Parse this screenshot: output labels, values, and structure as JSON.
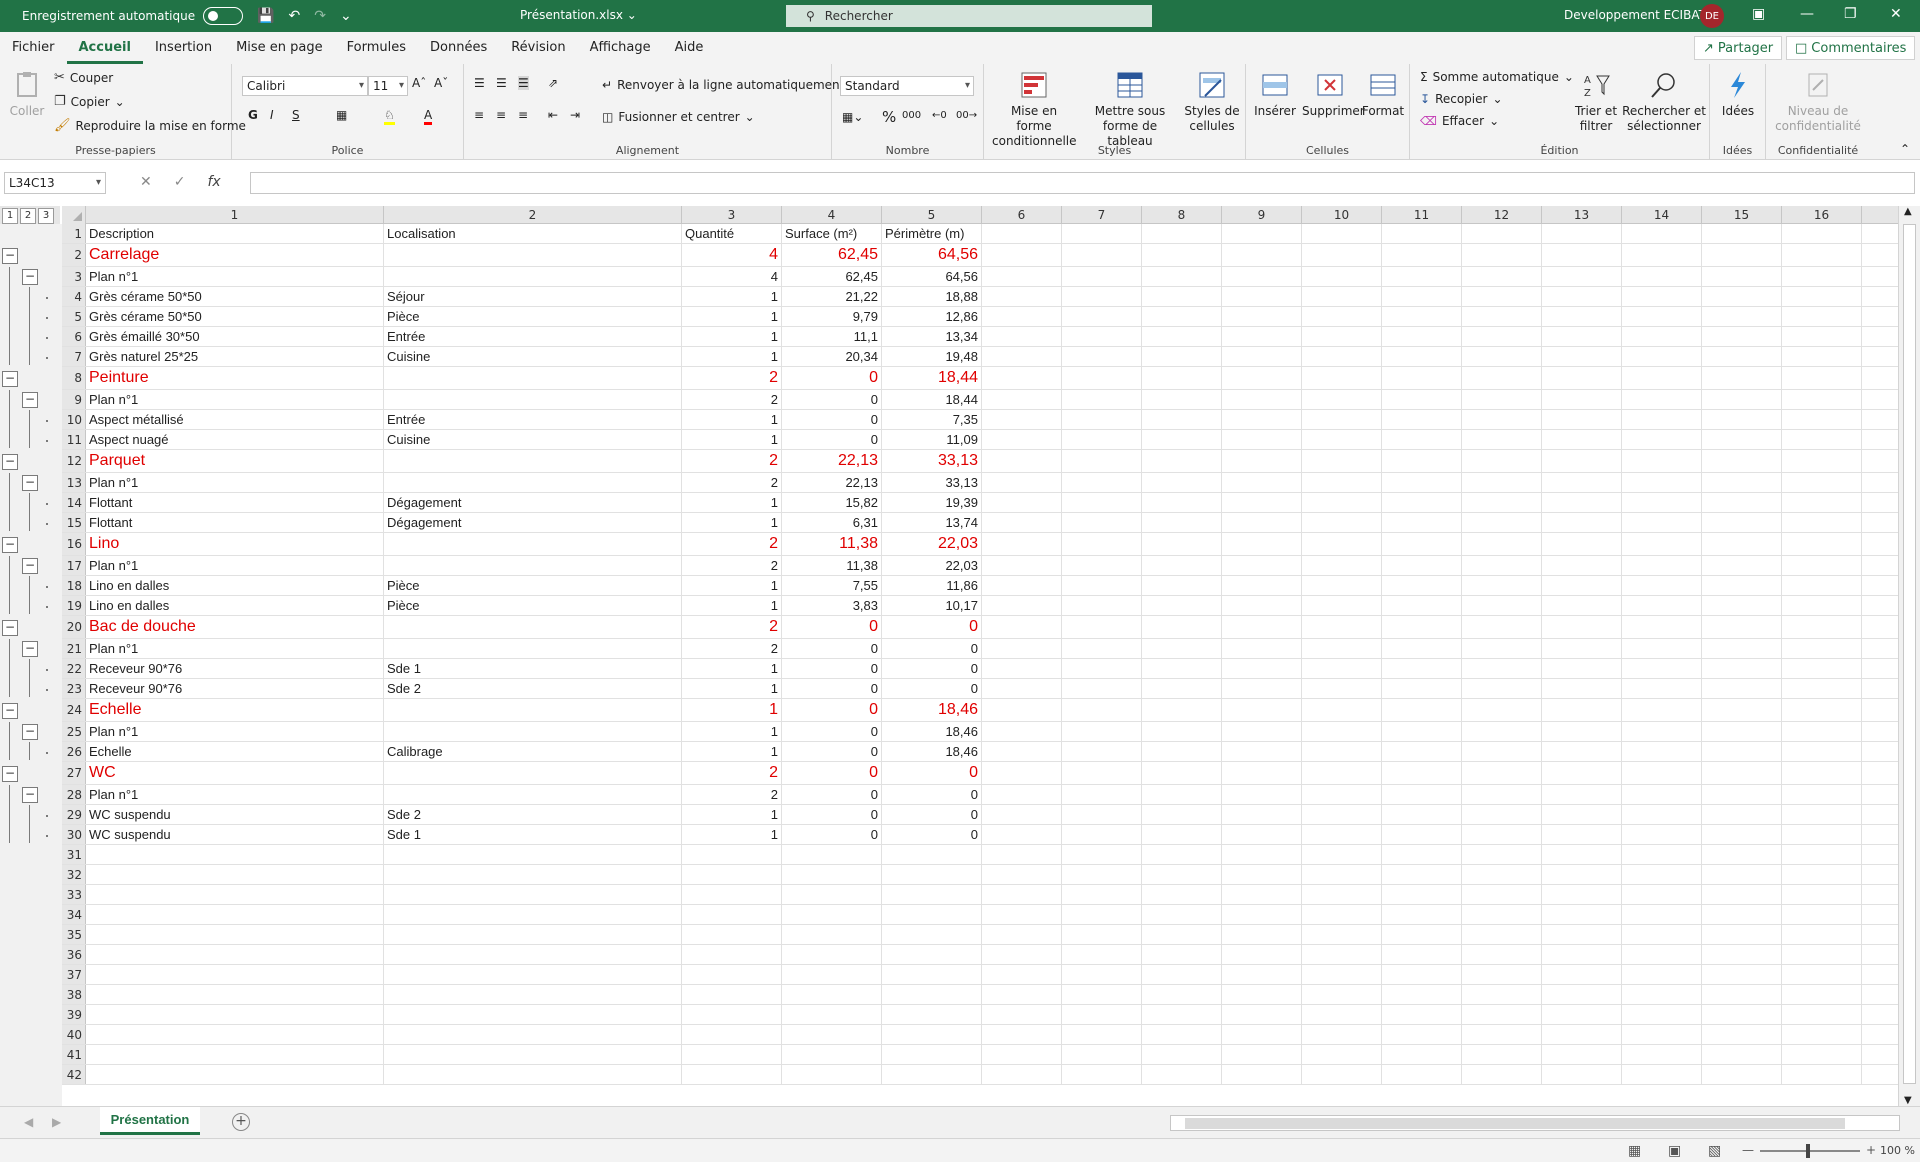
{
  "titlebar": {
    "autosave_label": "Enregistrement automatique",
    "doc_title": "Présentation.xlsx",
    "search_placeholder": "Rechercher",
    "user_name": "Developpement ECIBAT",
    "avatar_initials": "DE"
  },
  "menu": {
    "items": [
      "Fichier",
      "Accueil",
      "Insertion",
      "Mise en page",
      "Formules",
      "Données",
      "Révision",
      "Affichage",
      "Aide"
    ],
    "active": "Accueil",
    "share_label": "Partager",
    "comments_label": "Commentaires"
  },
  "ribbon": {
    "clipboard": {
      "paste_label": "Coller",
      "cut_label": "Couper",
      "copy_label": "Copier",
      "format_painter_label": "Reproduire la mise en forme",
      "group_label": "Presse-papiers"
    },
    "font": {
      "font_name": "Calibri",
      "font_size": "11",
      "group_label": "Police"
    },
    "alignment": {
      "wrap_label": "Renvoyer à la ligne automatiquement",
      "merge_label": "Fusionner et centrer",
      "group_label": "Alignement"
    },
    "number": {
      "format": "Standard",
      "group_label": "Nombre"
    },
    "styles": {
      "conditional_label": "Mise en forme conditionnelle",
      "table_label": "Mettre sous forme de tableau",
      "cell_styles_label": "Styles de cellules",
      "group_label": "Styles"
    },
    "cells": {
      "insert_label": "Insérer",
      "delete_label": "Supprimer",
      "format_label": "Format",
      "group_label": "Cellules"
    },
    "editing": {
      "autosum_label": "Somme automatique",
      "fill_label": "Recopier",
      "clear_label": "Effacer",
      "sort_label": "Trier et filtrer",
      "find_label": "Rechercher et sélectionner",
      "group_label": "Édition"
    },
    "ideas": {
      "ideas_label": "Idées",
      "group_label": "Idées"
    },
    "sensitivity": {
      "label": "Niveau de confidentialité",
      "group_label": "Confidentialité"
    }
  },
  "formula_bar": {
    "name_box": "L34C13",
    "fx_label": "fx",
    "formula": ""
  },
  "grid": {
    "outline_levels": [
      "1",
      "2",
      "3"
    ],
    "columns": [
      "1",
      "2",
      "3",
      "4",
      "5",
      "6",
      "7",
      "8",
      "9",
      "10",
      "11",
      "12",
      "13",
      "14",
      "15",
      "16"
    ],
    "rows": [
      {
        "n": "1",
        "type": "header",
        "c1": "Description",
        "c2": "Localisation",
        "c3": "Quantité",
        "c4": "Surface (m²)",
        "c5": "Périmètre (m)"
      },
      {
        "n": "2",
        "type": "group",
        "c1": "Carrelage",
        "c2": "",
        "c3": "4",
        "c4": "62,45",
        "c5": "64,56"
      },
      {
        "n": "3",
        "type": "plan",
        "c1": "Plan n°1",
        "c2": "",
        "c3": "4",
        "c4": "62,45",
        "c5": "64,56"
      },
      {
        "n": "4",
        "type": "item",
        "c1": "Grès cérame 50*50",
        "c2": "Séjour",
        "c3": "1",
        "c4": "21,22",
        "c5": "18,88"
      },
      {
        "n": "5",
        "type": "item",
        "c1": "Grès cérame 50*50",
        "c2": "Pièce",
        "c3": "1",
        "c4": "9,79",
        "c5": "12,86"
      },
      {
        "n": "6",
        "type": "item",
        "c1": "Grès émaillé 30*50",
        "c2": "Entrée",
        "c3": "1",
        "c4": "11,1",
        "c5": "13,34"
      },
      {
        "n": "7",
        "type": "item",
        "c1": "Grès naturel 25*25",
        "c2": "Cuisine",
        "c3": "1",
        "c4": "20,34",
        "c5": "19,48"
      },
      {
        "n": "8",
        "type": "group",
        "c1": "Peinture",
        "c2": "",
        "c3": "2",
        "c4": "0",
        "c5": "18,44"
      },
      {
        "n": "9",
        "type": "plan",
        "c1": "Plan n°1",
        "c2": "",
        "c3": "2",
        "c4": "0",
        "c5": "18,44"
      },
      {
        "n": "10",
        "type": "item",
        "c1": "Aspect métallisé",
        "c2": "Entrée",
        "c3": "1",
        "c4": "0",
        "c5": "7,35"
      },
      {
        "n": "11",
        "type": "item",
        "c1": "Aspect nuagé",
        "c2": "Cuisine",
        "c3": "1",
        "c4": "0",
        "c5": "11,09"
      },
      {
        "n": "12",
        "type": "group",
        "c1": "Parquet",
        "c2": "",
        "c3": "2",
        "c4": "22,13",
        "c5": "33,13"
      },
      {
        "n": "13",
        "type": "plan",
        "c1": "Plan n°1",
        "c2": "",
        "c3": "2",
        "c4": "22,13",
        "c5": "33,13"
      },
      {
        "n": "14",
        "type": "item",
        "c1": "Flottant",
        "c2": "Dégagement",
        "c3": "1",
        "c4": "15,82",
        "c5": "19,39"
      },
      {
        "n": "15",
        "type": "item",
        "c1": "Flottant",
        "c2": "Dégagement",
        "c3": "1",
        "c4": "6,31",
        "c5": "13,74"
      },
      {
        "n": "16",
        "type": "group",
        "c1": "Lino",
        "c2": "",
        "c3": "2",
        "c4": "11,38",
        "c5": "22,03"
      },
      {
        "n": "17",
        "type": "plan",
        "c1": "Plan n°1",
        "c2": "",
        "c3": "2",
        "c4": "11,38",
        "c5": "22,03"
      },
      {
        "n": "18",
        "type": "item",
        "c1": "Lino en dalles",
        "c2": "Pièce",
        "c3": "1",
        "c4": "7,55",
        "c5": "11,86"
      },
      {
        "n": "19",
        "type": "item",
        "c1": "Lino en dalles",
        "c2": "Pièce",
        "c3": "1",
        "c4": "3,83",
        "c5": "10,17"
      },
      {
        "n": "20",
        "type": "group",
        "c1": "Bac de douche",
        "c2": "",
        "c3": "2",
        "c4": "0",
        "c5": "0"
      },
      {
        "n": "21",
        "type": "plan",
        "c1": "Plan n°1",
        "c2": "",
        "c3": "2",
        "c4": "0",
        "c5": "0"
      },
      {
        "n": "22",
        "type": "item",
        "c1": "Receveur 90*76",
        "c2": "Sde 1",
        "c3": "1",
        "c4": "0",
        "c5": "0"
      },
      {
        "n": "23",
        "type": "item",
        "c1": "Receveur 90*76",
        "c2": "Sde 2",
        "c3": "1",
        "c4": "0",
        "c5": "0"
      },
      {
        "n": "24",
        "type": "group",
        "c1": "Echelle",
        "c2": "",
        "c3": "1",
        "c4": "0",
        "c5": "18,46"
      },
      {
        "n": "25",
        "type": "plan",
        "c1": "Plan n°1",
        "c2": "",
        "c3": "1",
        "c4": "0",
        "c5": "18,46"
      },
      {
        "n": "26",
        "type": "item",
        "c1": "Echelle",
        "c2": "Calibrage",
        "c3": "1",
        "c4": "0",
        "c5": "18,46"
      },
      {
        "n": "27",
        "type": "group",
        "c1": "WC",
        "c2": "",
        "c3": "2",
        "c4": "0",
        "c5": "0"
      },
      {
        "n": "28",
        "type": "plan",
        "c1": "Plan n°1",
        "c2": "",
        "c3": "2",
        "c4": "0",
        "c5": "0"
      },
      {
        "n": "29",
        "type": "item",
        "c1": "WC suspendu",
        "c2": "Sde 2",
        "c3": "1",
        "c4": "0",
        "c5": "0"
      },
      {
        "n": "30",
        "type": "item",
        "c1": "WC suspendu",
        "c2": "Sde 1",
        "c3": "1",
        "c4": "0",
        "c5": "0"
      },
      {
        "n": "31",
        "type": "empty"
      },
      {
        "n": "32",
        "type": "empty"
      },
      {
        "n": "33",
        "type": "empty"
      },
      {
        "n": "34",
        "type": "empty"
      },
      {
        "n": "35",
        "type": "empty"
      },
      {
        "n": "36",
        "type": "empty"
      },
      {
        "n": "37",
        "type": "empty"
      },
      {
        "n": "38",
        "type": "empty"
      },
      {
        "n": "39",
        "type": "empty"
      },
      {
        "n": "40",
        "type": "empty"
      },
      {
        "n": "41",
        "type": "empty"
      },
      {
        "n": "42",
        "type": "empty"
      }
    ]
  },
  "sheets": {
    "tabs": [
      "Présentation"
    ],
    "active": "Présentation"
  },
  "statusbar": {
    "zoom": "100 %"
  },
  "colors": {
    "excel_green": "#217346",
    "group_red": "#e00000"
  }
}
